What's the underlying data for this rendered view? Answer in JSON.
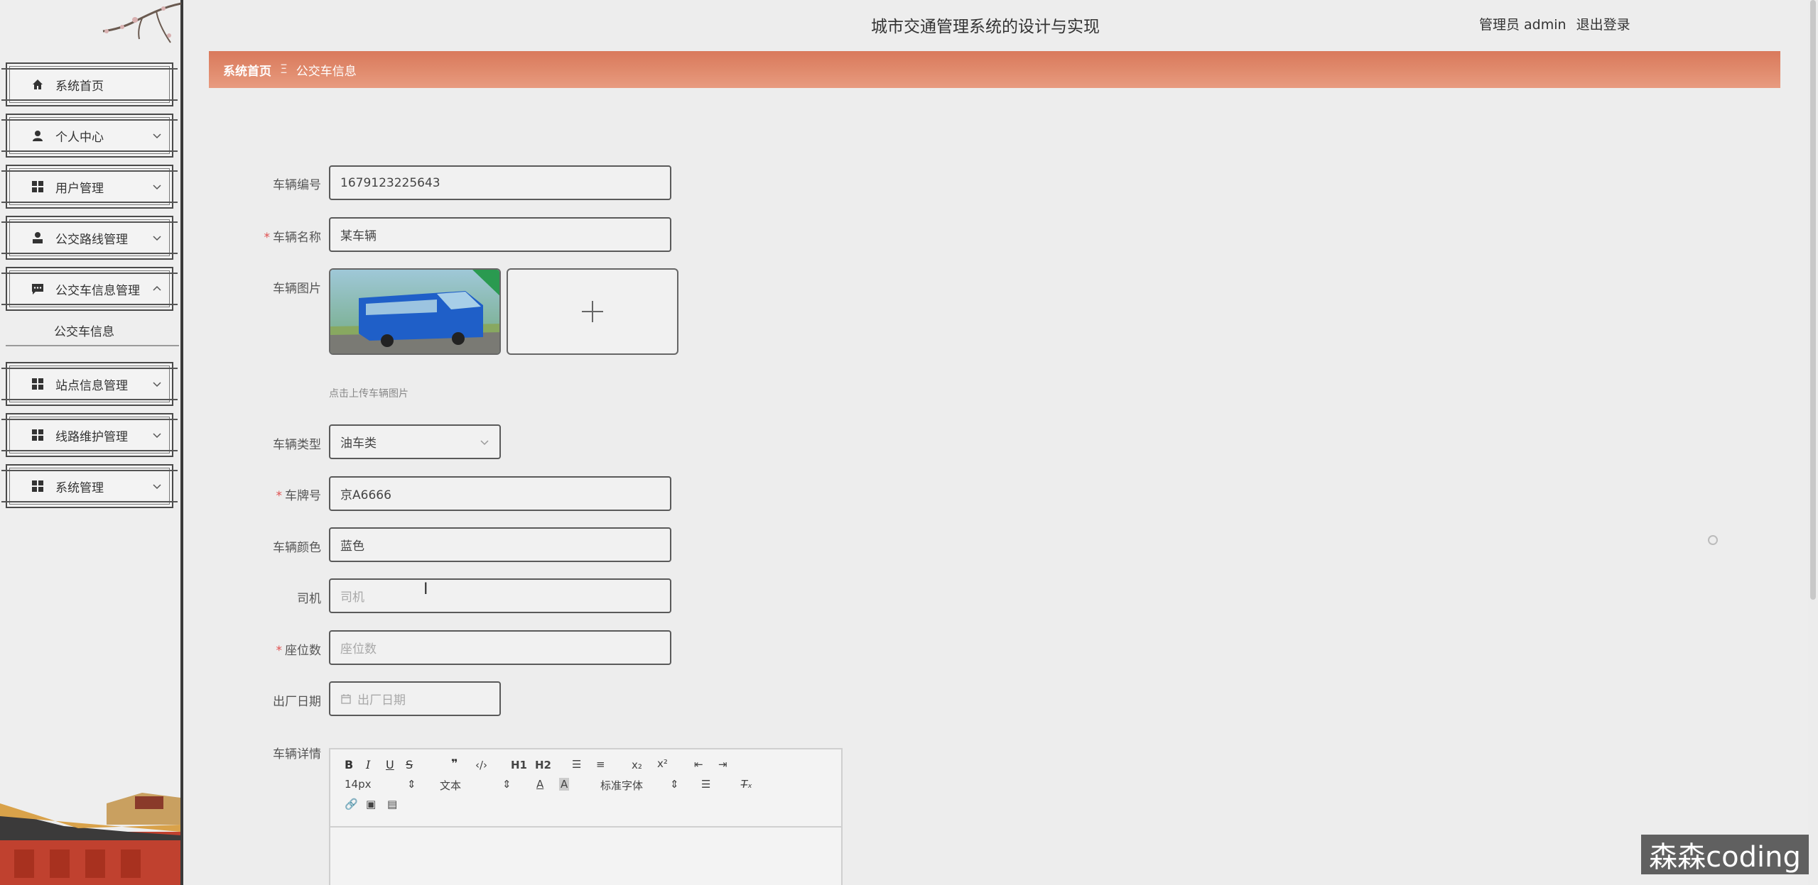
{
  "header": {
    "app_title": "城市交通管理系统的设计与实现",
    "role": "管理员 admin",
    "logout": "退出登录"
  },
  "breadcrumb": {
    "home": "系统首页",
    "separator": "Ξ",
    "current": "公交车信息"
  },
  "sidebar": {
    "items": [
      {
        "label": "系统首页",
        "icon": "home-icon",
        "has_chevron": false
      },
      {
        "label": "个人中心",
        "icon": "user-icon",
        "has_chevron": true
      },
      {
        "label": "用户管理",
        "icon": "grid-icon",
        "has_chevron": true
      },
      {
        "label": "公交路线管理",
        "icon": "person-icon",
        "has_chevron": true
      },
      {
        "label": "公交车信息管理",
        "icon": "message-icon",
        "has_chevron": true,
        "expanded": true
      },
      {
        "label": "站点信息管理",
        "icon": "grid-icon",
        "has_chevron": true
      },
      {
        "label": "线路维护管理",
        "icon": "grid-icon",
        "has_chevron": true
      },
      {
        "label": "系统管理",
        "icon": "grid-icon",
        "has_chevron": true
      }
    ],
    "submenu": {
      "label": "公交车信息"
    }
  },
  "form": {
    "vehicle_no": {
      "label": "车辆编号",
      "value": "1679123225643",
      "required": false
    },
    "vehicle_name": {
      "label": "车辆名称",
      "value": "某车辆",
      "required": true
    },
    "vehicle_image": {
      "label": "车辆图片",
      "hint": "点击上传车辆图片"
    },
    "vehicle_type": {
      "label": "车辆类型",
      "value": "油车类",
      "required": false
    },
    "plate_no": {
      "label": "车牌号",
      "value": "京A6666",
      "required": true
    },
    "vehicle_color": {
      "label": "车辆颜色",
      "value": "蓝色",
      "required": false
    },
    "driver": {
      "label": "司机",
      "placeholder": "司机",
      "required": false
    },
    "seats": {
      "label": "座位数",
      "placeholder": "座位数",
      "required": true
    },
    "factory_date": {
      "label": "出厂日期",
      "placeholder": "出厂日期",
      "required": false
    },
    "details": {
      "label": "车辆详情"
    }
  },
  "editor": {
    "font_size": "14px",
    "text_type": "文本",
    "font_family": "标准字体",
    "h1": "H1",
    "h2": "H2"
  },
  "watermark": "森森coding",
  "colors": {
    "breadcrumb_start": "#d9795c",
    "breadcrumb_end": "#e89b80",
    "required_star": "#e05050"
  }
}
